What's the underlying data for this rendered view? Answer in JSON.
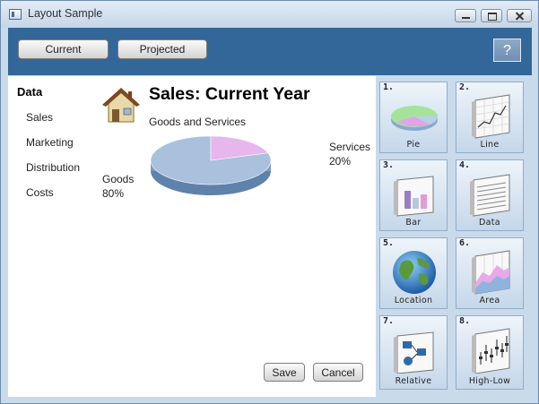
{
  "window": {
    "title": "Layout Sample"
  },
  "toolbar": {
    "current_label": "Current",
    "projected_label": "Projected",
    "help_label": "?"
  },
  "sidebar": {
    "title": "Data",
    "items": [
      {
        "label": "Sales"
      },
      {
        "label": "Marketing"
      },
      {
        "label": "Distribution"
      },
      {
        "label": "Costs"
      }
    ]
  },
  "main": {
    "title": "Sales:  Current Year",
    "subtitle": "Goods and Services",
    "save_label": "Save",
    "cancel_label": "Cancel"
  },
  "chart_data": {
    "type": "pie",
    "title": "Goods and Services",
    "slices": [
      {
        "label": "Goods",
        "value": 80,
        "display": "80%",
        "color": "#a9c1dc"
      },
      {
        "label": "Services",
        "value": 20,
        "display": "20%",
        "color": "#e7b6ec"
      }
    ]
  },
  "tiles": [
    {
      "num": "1.",
      "label": "Pie",
      "icon": "pie-chart-icon"
    },
    {
      "num": "2.",
      "label": "Line",
      "icon": "line-chart-icon"
    },
    {
      "num": "3.",
      "label": "Bar",
      "icon": "bar-chart-icon"
    },
    {
      "num": "4.",
      "label": "Data",
      "icon": "data-sheet-icon"
    },
    {
      "num": "5.",
      "label": "Location",
      "icon": "globe-icon"
    },
    {
      "num": "6.",
      "label": "Area",
      "icon": "area-chart-icon"
    },
    {
      "num": "7.",
      "label": "Relative",
      "icon": "flowchart-icon"
    },
    {
      "num": "8.",
      "label": "High-Low",
      "icon": "high-low-chart-icon"
    }
  ],
  "colors": {
    "toolbar_bg": "#336699",
    "window_bg": "#c9daeb",
    "tile_border": "#8faecb"
  }
}
